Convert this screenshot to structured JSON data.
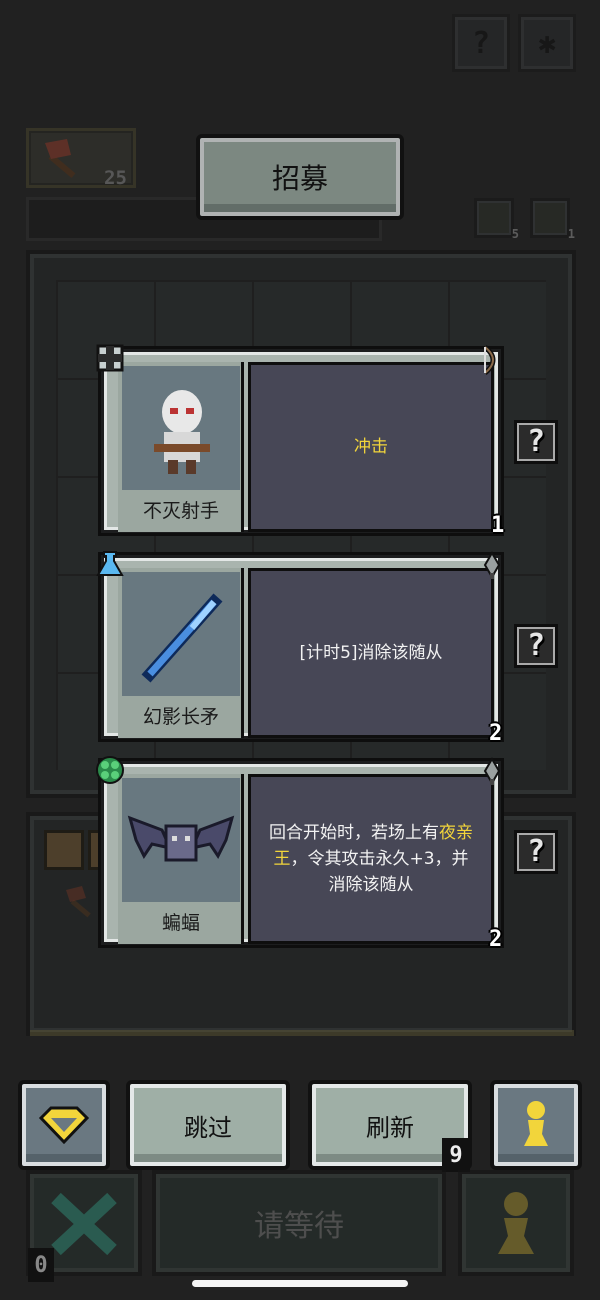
{
  "top": {
    "help_glyph": "?",
    "settings_glyph": "✱"
  },
  "inventory": {
    "icon": "axe-icon",
    "count": "25"
  },
  "title": "招募",
  "small_icons": {
    "swap_count": "5",
    "pawn_count": "1"
  },
  "cards": [
    {
      "name": "不灭射手",
      "description_parts": [
        {
          "text": "冲击",
          "keyword": true
        }
      ],
      "tier": "1",
      "left_corner_icon": "shield-cross-icon",
      "right_corner_icon": "bow-icon",
      "help": "?"
    },
    {
      "name": "幻影长矛",
      "description_parts": [
        {
          "text": "[计时5]消除该随从",
          "keyword": false
        }
      ],
      "tier": "2",
      "left_corner_icon": "potion-flask-icon",
      "right_corner_icon": "dagger-icon",
      "help": "?"
    },
    {
      "name": "蝙蝠",
      "description_parts": [
        {
          "text": "回合开始时，若场上有",
          "keyword": false
        },
        {
          "text": "夜亲王",
          "keyword": true
        },
        {
          "text": "，令其攻击永久+3，并消除该随从",
          "keyword": false
        }
      ],
      "tier": "2",
      "left_corner_icon": "clover-icon",
      "right_corner_icon": "dagger-icon",
      "help": "?"
    }
  ],
  "actions": {
    "gem_icon": "diamond-icon",
    "skip": "跳过",
    "refresh": "刷新",
    "refresh_count": "9",
    "pawn_icon": "pawn-icon"
  },
  "bottom": {
    "wait": "请等待",
    "zero": "0"
  },
  "colors": {
    "keyword": "#f2d53b",
    "button": "#9fafa6",
    "desc_bg": "#474756"
  }
}
